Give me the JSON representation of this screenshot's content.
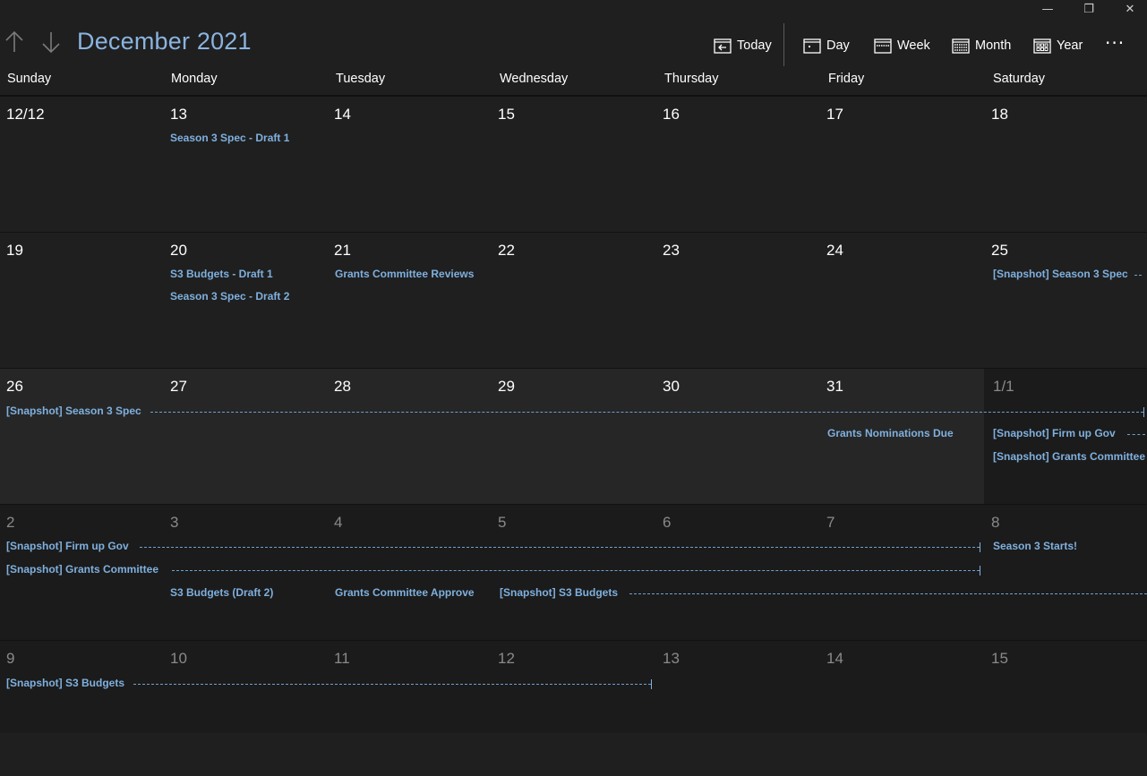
{
  "window": {
    "minimize_glyph": "—",
    "restore_glyph": "❐",
    "close_glyph": "✕"
  },
  "header": {
    "title": "December 2021",
    "prev_icon": "up-arrow-icon",
    "next_icon": "down-arrow-icon",
    "buttons": {
      "today": "Today",
      "day": "Day",
      "week": "Week",
      "month": "Month",
      "year": "Year"
    },
    "more": "···"
  },
  "colors": {
    "accent": "#8ab4e0",
    "event": "#7fb0de",
    "background": "#1f1f1f"
  },
  "weekdays": [
    "Sunday",
    "Monday",
    "Tuesday",
    "Wednesday",
    "Thursday",
    "Friday",
    "Saturday"
  ],
  "weeks": [
    {
      "days": [
        "12/12",
        "13",
        "14",
        "15",
        "16",
        "17",
        "18"
      ],
      "events": {
        "mon_1": "Season 3 Spec - Draft 1"
      }
    },
    {
      "days": [
        "19",
        "20",
        "21",
        "22",
        "23",
        "24",
        "25"
      ],
      "events": {
        "mon_1": "S3 Budgets - Draft 1",
        "mon_2": "Season 3 Spec - Draft 2",
        "tue_1": "Grants Committee Reviews",
        "sat_1": "[Snapshot] Season 3 Spec"
      }
    },
    {
      "days": [
        "26",
        "27",
        "28",
        "29",
        "30",
        "31",
        "1/1"
      ],
      "events": {
        "span_1": "[Snapshot] Season 3 Spec",
        "fri_1": "Grants Nominations Due",
        "sat_1": "[Snapshot] Firm up Gov",
        "sat_2": "[Snapshot] Grants Committee"
      }
    },
    {
      "days": [
        "2",
        "3",
        "4",
        "5",
        "6",
        "7",
        "8"
      ],
      "events": {
        "span_1": "[Snapshot] Firm up Gov",
        "span_2": "[Snapshot] Grants Committee",
        "mon_1": "S3 Budgets (Draft 2)",
        "tue_1": "Grants Committee Approve",
        "wed_span": "[Snapshot] S3 Budgets",
        "sat_1": "Season 3 Starts!"
      }
    },
    {
      "days": [
        "9",
        "10",
        "11",
        "12",
        "13",
        "14",
        "15"
      ],
      "events": {
        "span_1": "[Snapshot] S3 Budgets"
      }
    }
  ]
}
